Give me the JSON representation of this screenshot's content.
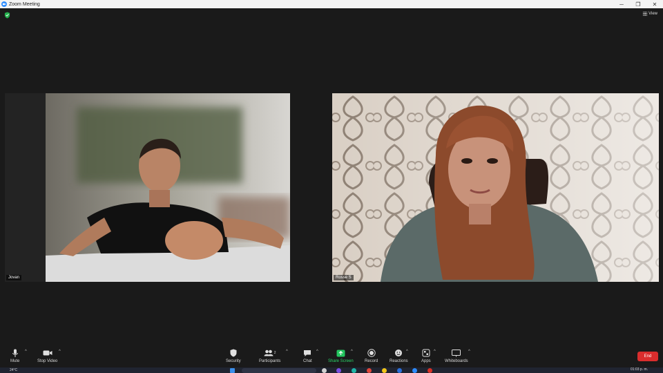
{
  "window": {
    "title": "Zoom Meeting",
    "minimize": "─",
    "maximize": "❐",
    "close": "✕"
  },
  "top": {
    "view_label": "View"
  },
  "participants": [
    {
      "name": "Jovan"
    },
    {
      "name": "Rosse S"
    }
  ],
  "toolbar": {
    "mute": "Mute",
    "stop_video": "Stop Video",
    "security": "Security",
    "participants": "Participants",
    "participants_count": "2",
    "chat": "Chat",
    "share_screen": "Share Screen",
    "record": "Record",
    "reactions": "Reactions",
    "apps": "Apps",
    "whiteboards": "Whiteboards",
    "end": "End"
  },
  "taskbar": {
    "weather": "24°C",
    "clock": "01:03 p. m."
  },
  "colors": {
    "accent_blue": "#2d8cff",
    "share_green": "#2bd56a",
    "end_red": "#d92d2d",
    "background": "#1a1a1a"
  }
}
